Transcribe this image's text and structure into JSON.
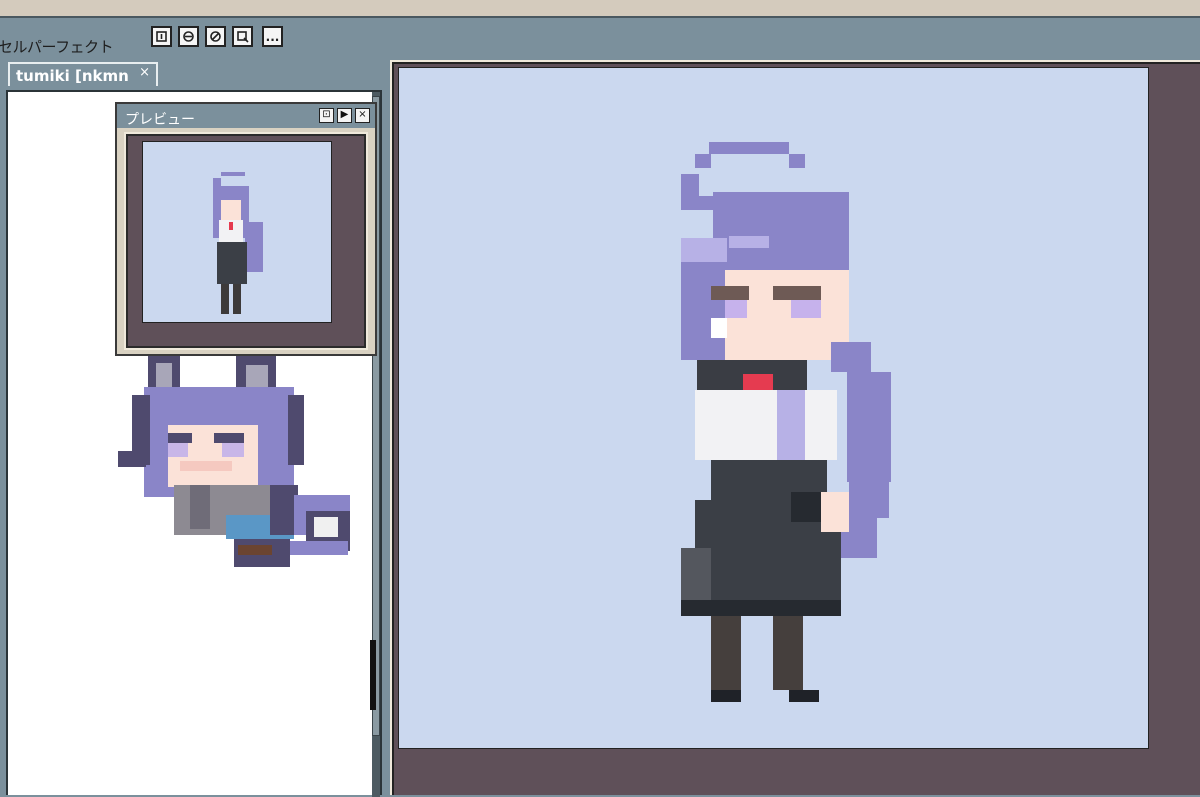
{
  "toolbar": {
    "label": "セルパーフェクト",
    "buttons": [
      {
        "icon": "layer-add-icon"
      },
      {
        "icon": "layer-merge-icon"
      },
      {
        "icon": "layer-clear-icon"
      },
      {
        "icon": "layer-zoom-icon"
      },
      {
        "icon": "more-icon",
        "label": "..."
      }
    ]
  },
  "tab": {
    "title": "tumiki [nkmn",
    "close": "×"
  },
  "preview": {
    "title": "プレビュー",
    "buttons": [
      {
        "icon": "fit-icon",
        "label": "⊡"
      },
      {
        "icon": "play-icon",
        "label": "▶"
      },
      {
        "icon": "close-icon",
        "label": "×"
      }
    ]
  },
  "colors": {
    "chrome": "#7b909c",
    "canvas_bg": "#cbd8ef",
    "workspace_bg": "#5f5059",
    "hair": "#8a85c8"
  }
}
